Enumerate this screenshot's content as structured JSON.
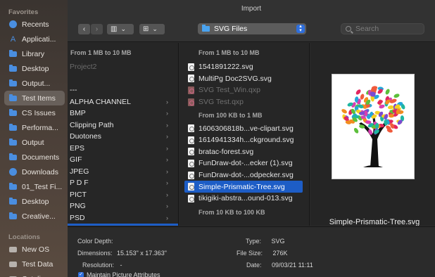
{
  "window": {
    "title": "Import"
  },
  "sidebar": {
    "favorites_header": "Favorites",
    "items": [
      {
        "label": "Recents",
        "icon": "clock-icon"
      },
      {
        "label": "Applicati...",
        "icon": "applications-icon"
      },
      {
        "label": "Library",
        "icon": "folder-icon"
      },
      {
        "label": "Desktop",
        "icon": "folder-icon"
      },
      {
        "label": "Output...",
        "icon": "folder-icon"
      },
      {
        "label": "Test Items",
        "icon": "folder-icon",
        "selected": true
      },
      {
        "label": "CS Issues",
        "icon": "folder-icon"
      },
      {
        "label": "Performa...",
        "icon": "folder-icon"
      },
      {
        "label": "Output",
        "icon": "folder-icon"
      },
      {
        "label": "Documents",
        "icon": "document-icon"
      },
      {
        "label": "Downloads",
        "icon": "download-icon"
      },
      {
        "label": "01_Test Fi...",
        "icon": "folder-icon"
      },
      {
        "label": "Desktop",
        "icon": "folder-icon"
      },
      {
        "label": "Creative...",
        "icon": "folder-icon"
      }
    ],
    "locations_header": "Locations",
    "locations": [
      {
        "label": "New OS",
        "icon": "drive-icon"
      },
      {
        "label": "Test Data",
        "icon": "drive-icon"
      },
      {
        "label": "Catalina",
        "icon": "drive-icon"
      }
    ]
  },
  "toolbar": {
    "back_glyph": "‹",
    "forward_glyph": "›",
    "column_view_glyph": "▥",
    "gallery_view_glyph": "⊞",
    "dropdown_glyph": "⌄",
    "path_label": "SVG Files",
    "search_placeholder": "Search"
  },
  "column1": {
    "header": "From 1 MB to 10 MB",
    "rows": [
      {
        "label": "Project2",
        "dim": true,
        "chevron": false
      },
      {
        "label": "",
        "dim": false,
        "chevron": false
      },
      {
        "label": "---",
        "dim": false,
        "chevron": false
      },
      {
        "label": "ALPHA CHANNEL",
        "dim": false,
        "chevron": true
      },
      {
        "label": "BMP",
        "dim": false,
        "chevron": true
      },
      {
        "label": "Clipping Path",
        "dim": false,
        "chevron": true
      },
      {
        "label": "Duotones",
        "dim": false,
        "chevron": true
      },
      {
        "label": "EPS",
        "dim": false,
        "chevron": true
      },
      {
        "label": "GIF",
        "dim": false,
        "chevron": true
      },
      {
        "label": "JPEG",
        "dim": false,
        "chevron": true
      },
      {
        "label": "P D F",
        "dim": false,
        "chevron": true
      },
      {
        "label": "PICT",
        "dim": false,
        "chevron": true
      },
      {
        "label": "PNG",
        "dim": false,
        "chevron": true
      },
      {
        "label": "PSD",
        "dim": false,
        "chevron": true
      },
      {
        "label": "SVG Files",
        "dim": false,
        "chevron": true,
        "selected": true
      }
    ]
  },
  "column2": {
    "header_1": "From 1 MB to 10 MB",
    "group_1": [
      {
        "label": "1541891222.svg",
        "dim": false
      },
      {
        "label": "MultiPg Doc2SVG.svg",
        "dim": false
      },
      {
        "label": "SVG Test_Win.qxp",
        "dim": true
      },
      {
        "label": "SVG Test.qxp",
        "dim": true
      }
    ],
    "header_2": "From 100 KB to 1 MB",
    "group_2": [
      {
        "label": "1606306818b...ve-clipart.svg",
        "dim": false
      },
      {
        "label": "1614941334h...ckground.svg",
        "dim": false
      },
      {
        "label": "bratac-forest.svg",
        "dim": false
      },
      {
        "label": "FunDraw-dot-...ecker (1).svg",
        "dim": false
      },
      {
        "label": "FunDraw-dot-...odpecker.svg",
        "dim": false
      },
      {
        "label": "Simple-Prismatic-Tree.svg",
        "dim": false,
        "selected": true
      },
      {
        "label": "tikigiki-abstra...ound-013.svg",
        "dim": false
      }
    ],
    "header_3": "From 10 KB to 100 KB"
  },
  "preview": {
    "filename": "Simple-Prismatic-Tree.svg"
  },
  "info": {
    "color_depth_label": "Color Depth:",
    "color_depth_value": "",
    "dimensions_label": "Dimensions:",
    "dimensions_value": "15.153\" x 17.363\"",
    "resolution_label": "Resolution:",
    "resolution_value": "-",
    "type_label": "Type:",
    "type_value": "SVG",
    "filesize_label": "File Size:",
    "filesize_value": "276K",
    "date_label": "Date:",
    "date_value": "09/03/21  11:11",
    "maintain_label": "Maintain Picture Attributes",
    "check_glyph": "✓"
  },
  "colors": {
    "accent": "#1d5dc6",
    "folder": "#4a8ee0"
  }
}
